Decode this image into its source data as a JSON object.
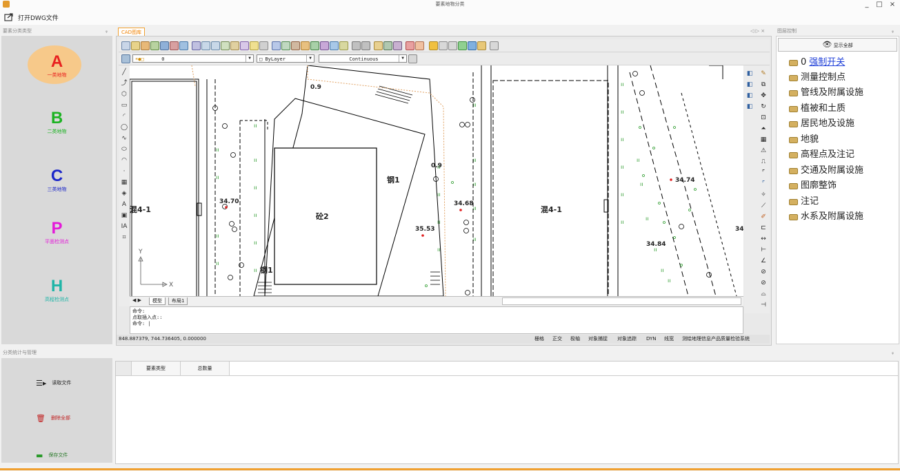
{
  "window": {
    "title": "要素地物分类",
    "minimize": "_",
    "maximize": "□",
    "close": "×"
  },
  "toolbar": {
    "open_dwg": "打开DWG文件"
  },
  "left_panel": {
    "header": "要素分类类型",
    "pin": "ᵩ",
    "categories": [
      {
        "letter": "A",
        "label": "一类地物",
        "color": "#e8201f"
      },
      {
        "letter": "B",
        "label": "二类地物",
        "color": "#1db323"
      },
      {
        "letter": "C",
        "label": "三类地物",
        "color": "#1c27c9"
      },
      {
        "letter": "P",
        "label": "平面检测点",
        "color": "#e41ad9"
      },
      {
        "letter": "H",
        "label": "高程检测点",
        "color": "#1fb5a7"
      }
    ]
  },
  "cad": {
    "tab": "CAD图库",
    "tab_controls": "◁ ▷ ×",
    "layer_combo": "0",
    "color_combo": "ByLayer",
    "linetype_combo": "Continuous",
    "layout_tabs": [
      "模型",
      "布局1"
    ],
    "command_lines": [
      "命令:",
      "点取插入点::",
      "命令: |"
    ],
    "coords": "848.887379,  744.736405,  0.000000",
    "status_items": [
      "栅格",
      "正交",
      "极轴",
      "对象捕捉",
      "对象追踪",
      "DYN",
      "线宽",
      "测绘地理信息产品质量检验系统"
    ],
    "labels": {
      "v09a": "0.9",
      "v09b": "0.9",
      "v3470": "34.70",
      "v3468": "34.68",
      "v3553": "35.53",
      "v3474": "34.74",
      "v3484": "34.84",
      "v34": "34.",
      "b1": "混4-1",
      "b2": "砼2",
      "b3": "钢1",
      "b4": "混4-1",
      "b5": "钢1"
    }
  },
  "right_panel": {
    "header": "图层控制",
    "pin": "ᵩ",
    "show_all": "显示全部",
    "force_switch_prefix": "0",
    "force_switch_link": "强制开关",
    "layers": [
      "测量控制点",
      "管线及附属设施",
      "植被和土质",
      "居民地及设施",
      "地貌",
      "高程点及注记",
      "交通及附属设施",
      "图廓整饰",
      "注记",
      "水系及附属设施"
    ]
  },
  "bottom": {
    "header": "分类统计与管理",
    "pin": "ᵩ",
    "columns": [
      "要素类型",
      "总数量"
    ],
    "buttons": [
      "读取文件",
      "删除全部",
      "保存文件"
    ]
  }
}
